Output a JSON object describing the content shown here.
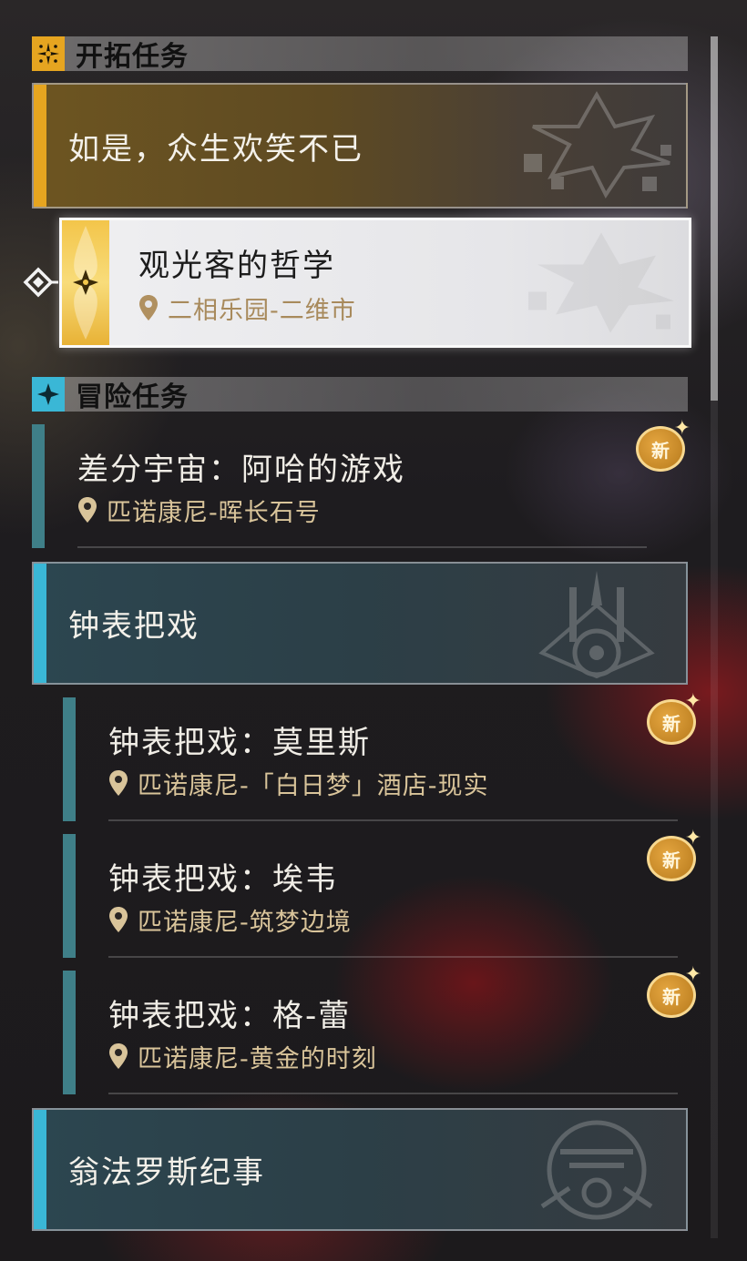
{
  "sections": {
    "trailblaze": {
      "title": "开拓任务"
    },
    "adventure": {
      "title": "冒险任务"
    }
  },
  "trailblaze_category": {
    "title": "如是，众生欢笑不已"
  },
  "selected_quest": {
    "title": "观光客的哲学",
    "location": "二相乐园-二维市"
  },
  "adventure_quests": [
    {
      "title": "差分宇宙：阿哈的游戏",
      "location": "匹诺康尼-晖长石号",
      "badge": "新"
    }
  ],
  "clockie_category": {
    "title": "钟表把戏"
  },
  "clockie_quests": [
    {
      "title": "钟表把戏：莫里斯",
      "location": "匹诺康尼-「白日梦」酒店-现实",
      "badge": "新"
    },
    {
      "title": "钟表把戏：埃韦",
      "location": "匹诺康尼-筑梦边境",
      "badge": "新"
    },
    {
      "title": "钟表把戏：格-蕾",
      "location": "匹诺康尼-黄金的时刻",
      "badge": "新"
    }
  ],
  "amphoreus_category": {
    "title": "翁法罗斯纪事"
  },
  "colors": {
    "trailblaze_accent": "#e6a520",
    "adventure_accent": "#3ab7d6",
    "quest_bar": "#3f7f88",
    "location_text": "#d9c49a"
  },
  "icons": {
    "trailblaze_section": "compass-star-icon",
    "adventure_section": "four-point-star-icon",
    "location": "map-pin-icon",
    "selected_marker": "diamond-arrow-icon"
  }
}
